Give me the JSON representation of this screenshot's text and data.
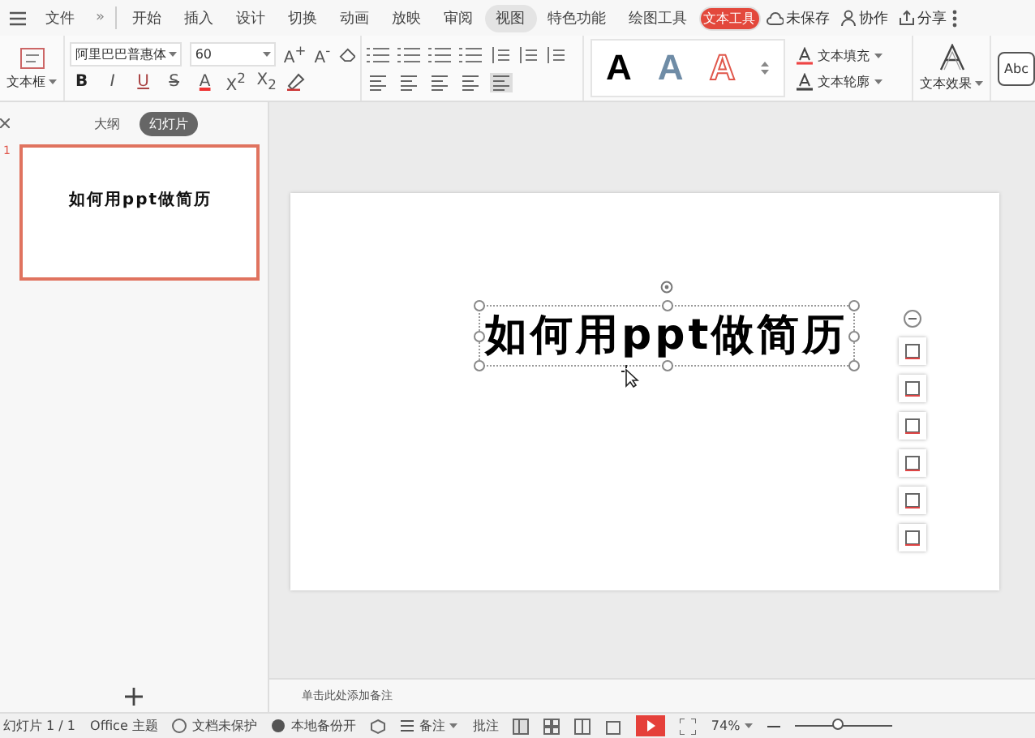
{
  "menu_bar": {
    "file_label": "文件",
    "more_label": "»",
    "tabs": [
      {
        "label": "开始",
        "selected": false,
        "highlighted": false
      },
      {
        "label": "插入",
        "selected": false,
        "highlighted": false
      },
      {
        "label": "设计",
        "selected": false,
        "highlighted": false
      },
      {
        "label": "切换",
        "selected": false,
        "highlighted": false
      },
      {
        "label": "动画",
        "selected": false,
        "highlighted": false
      },
      {
        "label": "放映",
        "selected": false,
        "highlighted": false
      },
      {
        "label": "审阅",
        "selected": false,
        "highlighted": false
      },
      {
        "label": "视图",
        "selected": false,
        "highlighted": true
      },
      {
        "label": "特色功能",
        "selected": false,
        "highlighted": false
      },
      {
        "label": "绘图工具",
        "selected": false,
        "highlighted": false
      },
      {
        "label": "文本工具",
        "selected": true,
        "highlighted": false
      }
    ],
    "actions": [
      {
        "label": "未保存",
        "kind": "cloud"
      },
      {
        "label": "协作",
        "kind": "person"
      },
      {
        "label": "分享",
        "kind": "share"
      }
    ]
  },
  "ribbon": {
    "textbox_label": "文本框",
    "font": "阿里巴巴普惠体",
    "size": "60",
    "size_buttons": [
      "A$^{+}$",
      "A$^{-}$"
    ],
    "format_buttons": [
      {
        "label": "B",
        "kind": "bold"
      },
      {
        "label": "I",
        "kind": "italic"
      },
      {
        "label": "U",
        "kind": "underline"
      },
      {
        "label": "S",
        "kind": "strike"
      },
      {
        "label": "A",
        "kind": "color"
      },
      {
        "label": "X$^{2}$",
        "kind": "plain"
      },
      {
        "label": "X$_{2}$",
        "kind": "plain"
      }
    ],
    "text_styles": [
      {
        "label": "A",
        "kind": "solid"
      },
      {
        "label": "A",
        "kind": "blue"
      },
      {
        "label": "A",
        "kind": "outline"
      }
    ],
    "fill_label": "文本填充",
    "outline_label": "文本轮廓",
    "effect_label": "文本效果",
    "shape_style": "Abc"
  },
  "side_panel": {
    "tabs": [
      {
        "label": "大纲",
        "selected": false
      },
      {
        "label": "幻灯片",
        "selected": true
      }
    ],
    "slides": [
      {
        "number": "1",
        "title": "如何用ppt做简历",
        "selected": true
      }
    ]
  },
  "slide": {
    "title": "如何用ppt做简历",
    "selected": true
  },
  "notes_placeholder": "单击此处添加备注",
  "status_bar": {
    "slide_info": "幻灯片 1 / 1",
    "theme": "Office 主题",
    "protection": "文档未保护",
    "backup": "本地备份开",
    "notes": "备注",
    "comments": "批注",
    "zoom": "74%",
    "level": 0.45
  }
}
